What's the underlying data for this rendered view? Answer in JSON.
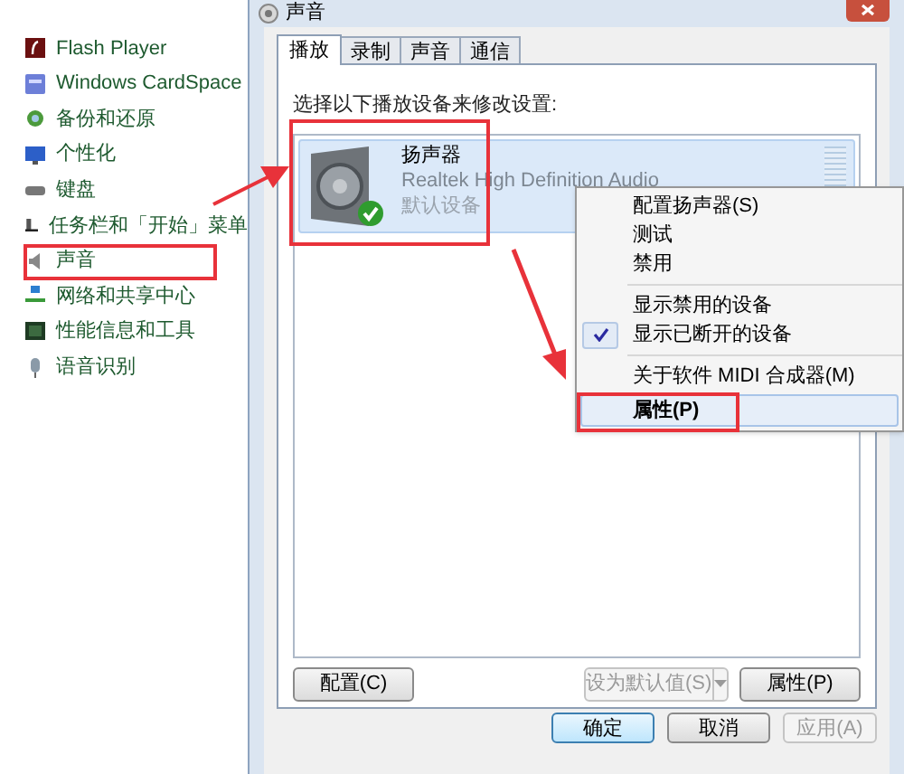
{
  "control_panel_items": [
    {
      "label": "Flash Player"
    },
    {
      "label": "Windows CardSpace"
    },
    {
      "label": "备份和还原"
    },
    {
      "label": "个性化"
    },
    {
      "label": "键盘"
    },
    {
      "label": "任务栏和「开始」菜单"
    },
    {
      "label": "声音"
    },
    {
      "label": "网络和共享中心"
    },
    {
      "label": "性能信息和工具"
    },
    {
      "label": "语音识别"
    }
  ],
  "window": {
    "title": "声音"
  },
  "tabs": [
    {
      "label": "播放",
      "selected": true
    },
    {
      "label": "录制",
      "selected": false
    },
    {
      "label": "声音",
      "selected": false
    },
    {
      "label": "通信",
      "selected": false
    }
  ],
  "instruction": "选择以下播放设备来修改设置:",
  "devices": [
    {
      "name": "扬声器",
      "driver": "Realtek High Definition Audio",
      "status": "默认设备",
      "selected": true,
      "default": true
    }
  ],
  "context_menu": [
    {
      "kind": "item",
      "label": "配置扬声器(S)",
      "checked": false,
      "highlighted": false
    },
    {
      "kind": "item",
      "label": "测试",
      "checked": false,
      "highlighted": false
    },
    {
      "kind": "item",
      "label": "禁用",
      "checked": false,
      "highlighted": false
    },
    {
      "kind": "separator"
    },
    {
      "kind": "item",
      "label": "显示禁用的设备",
      "checked": false,
      "highlighted": false
    },
    {
      "kind": "item",
      "label": "显示已断开的设备",
      "checked": true,
      "highlighted": false
    },
    {
      "kind": "separator"
    },
    {
      "kind": "item",
      "label": "关于软件 MIDI 合成器(M)",
      "checked": false,
      "highlighted": false
    },
    {
      "kind": "item",
      "label": "属性(P)",
      "checked": false,
      "highlighted": true
    }
  ],
  "panel_buttons": [
    {
      "kind": "button",
      "label": "配置(C)",
      "disabled": false
    },
    {
      "kind": "split",
      "label": "设为默认值(S)",
      "disabled": true
    },
    {
      "kind": "button",
      "label": "属性(P)",
      "disabled": false
    }
  ],
  "dialog_buttons": [
    {
      "label": "确定",
      "default": true,
      "disabled": false
    },
    {
      "label": "取消",
      "default": false,
      "disabled": false
    },
    {
      "label": "应用(A)",
      "default": false,
      "disabled": true
    }
  ]
}
